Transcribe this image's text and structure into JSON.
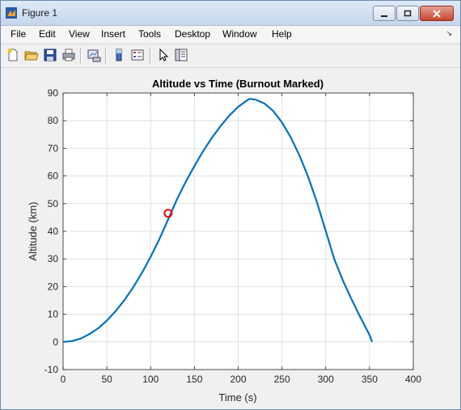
{
  "window": {
    "title": "Figure 1",
    "icons": {
      "app": "matlab-figure-icon",
      "minimize": "minimize-icon",
      "maximize": "maximize-icon",
      "close": "close-icon"
    }
  },
  "menubar": {
    "items": [
      "File",
      "Edit",
      "View",
      "Insert",
      "Tools",
      "Desktop",
      "Window",
      "Help"
    ],
    "dock_arrow": "↘"
  },
  "toolbar": {
    "icons": [
      "new-figure-icon",
      "open-file-icon",
      "save-icon",
      "print-icon",
      "link-plot-icon",
      "colorbar-icon",
      "legend-icon",
      "pointer-icon",
      "property-editor-icon"
    ]
  },
  "chart_data": {
    "type": "line",
    "title": "Altitude vs Time (Burnout Marked)",
    "xlabel": "Time (s)",
    "ylabel": "Altitude (km)",
    "xlim": [
      0,
      400
    ],
    "ylim": [
      -10,
      90
    ],
    "xticks": [
      0,
      50,
      100,
      150,
      200,
      250,
      300,
      350,
      400
    ],
    "yticks": [
      -10,
      0,
      10,
      20,
      30,
      40,
      50,
      60,
      70,
      80,
      90
    ],
    "grid": true,
    "series": [
      {
        "color": "#0072bd",
        "x": [
          0,
          10,
          20,
          30,
          40,
          50,
          60,
          70,
          80,
          90,
          100,
          110,
          120,
          130,
          140,
          150,
          160,
          170,
          180,
          190,
          200,
          210,
          213,
          220,
          230,
          240,
          250,
          260,
          270,
          280,
          290,
          300,
          310,
          320,
          330,
          340,
          350,
          353
        ],
        "y": [
          0,
          0.3,
          1.2,
          2.8,
          4.9,
          7.7,
          11.1,
          15.1,
          19.7,
          24.9,
          30.8,
          37.2,
          44.3,
          51.5,
          57.8,
          63.6,
          69.0,
          73.8,
          78.1,
          81.9,
          85.0,
          87.3,
          87.9,
          87.6,
          86.2,
          83.5,
          79.4,
          74.0,
          67.4,
          59.6,
          50.5,
          40.1,
          29.7,
          21.9,
          15.1,
          8.6,
          2.5,
          0
        ]
      }
    ],
    "markers": [
      {
        "label": "burnout",
        "x": 120,
        "y": 46.5,
        "color": "#ff0000"
      }
    ]
  }
}
